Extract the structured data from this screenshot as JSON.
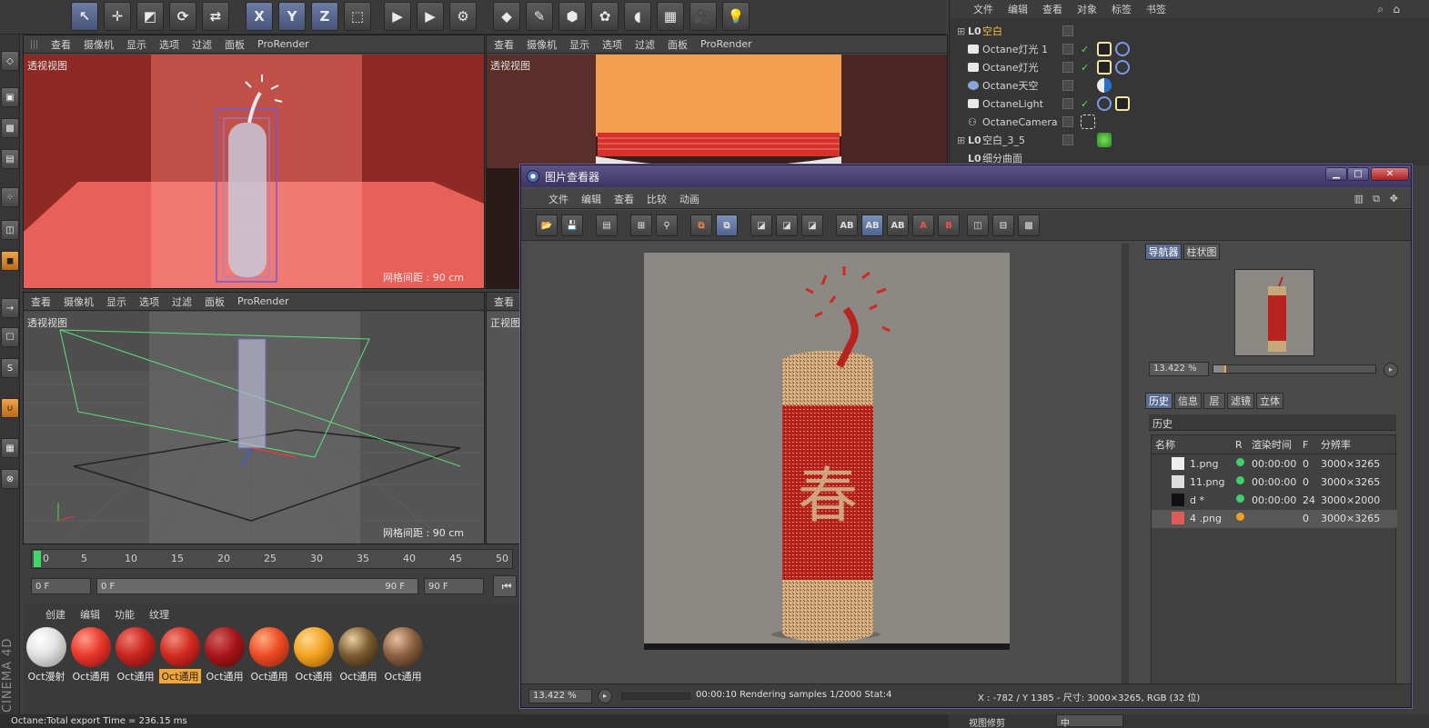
{
  "top_toolbar": {
    "axis_x": "X",
    "axis_y": "Y",
    "axis_z": "Z"
  },
  "viewports": [
    {
      "menu": [
        "查看",
        "摄像机",
        "显示",
        "选项",
        "过滤",
        "面板",
        "ProRender"
      ],
      "label": "透视视图",
      "grid": "网格间距 : 90 cm"
    },
    {
      "menu": [
        "查看",
        "摄像机",
        "显示",
        "选项",
        "过滤",
        "面板",
        "ProRender"
      ],
      "label": "透视视图"
    },
    {
      "menu": [
        "查看",
        "摄像机",
        "显示",
        "选项",
        "过滤",
        "面板",
        "ProRender"
      ],
      "label": "透视视图",
      "grid": "网格间距 : 90 cm"
    },
    {
      "menu": [
        "查看"
      ],
      "label": "正视图"
    }
  ],
  "object_manager": {
    "menu": [
      "文件",
      "编辑",
      "查看",
      "对象",
      "标签",
      "书签"
    ],
    "objects": [
      {
        "name": "空白",
        "highlight": true
      },
      {
        "name": "Octane灯光 1"
      },
      {
        "name": "Octane灯光"
      },
      {
        "name": "Octane天空"
      },
      {
        "name": "OctaneLight"
      },
      {
        "name": "OctaneCamera"
      },
      {
        "name": "空白_3_5"
      },
      {
        "name": "细分曲面"
      }
    ]
  },
  "timeline": {
    "ticks": [
      "0",
      "5",
      "10",
      "15",
      "20",
      "25",
      "30",
      "35",
      "40",
      "45",
      "50"
    ],
    "current_field": "0 F",
    "slider_start": "0 F",
    "slider_end": "90 F",
    "end_field": "90 F"
  },
  "material_manager": {
    "menu": [
      "创建",
      "编辑",
      "功能",
      "纹理"
    ],
    "materials": [
      {
        "label": "Oct漫射",
        "color": "#e4e4e4"
      },
      {
        "label": "Oct通用",
        "color": "#e8372a"
      },
      {
        "label": "Oct通用",
        "color": "#c8241f"
      },
      {
        "label": "Oct通用",
        "color": "#d02a20",
        "selected": true
      },
      {
        "label": "Oct通用",
        "color": "#a8151a"
      },
      {
        "label": "Oct通用",
        "color": "#ee4a22"
      },
      {
        "label": "Oct通用",
        "color": "#f3a21e"
      },
      {
        "label": "Oct通用",
        "color": "#7a5a30"
      },
      {
        "label": "Oct通用",
        "color": "#8a6040"
      }
    ]
  },
  "status_bar": {
    "text": "Octane:Total export Time = 236.15 ms",
    "c4d_logo": "CINEMA 4D",
    "right_label": "视图修剪",
    "right_value": "中"
  },
  "picture_viewer": {
    "title": "图片查看器",
    "menu": [
      "文件",
      "编辑",
      "查看",
      "比较",
      "动画"
    ],
    "side_tabs": [
      "导航器",
      "柱状图"
    ],
    "zoom": "13.422 %",
    "info_tabs": [
      "历史",
      "信息",
      "层",
      "滤镜",
      "立体"
    ],
    "history_title": "历史",
    "history_headers": [
      "名称",
      "R",
      "渲染时间",
      "F",
      "分辨率"
    ],
    "history_rows": [
      {
        "name": "1.png",
        "status_color": "#3fce6a",
        "time": "00:00:00",
        "frame": "0",
        "res": "3000×3265"
      },
      {
        "name": "11.png",
        "status_color": "#3fce6a",
        "time": "00:00:00",
        "frame": "0",
        "res": "3000×3265"
      },
      {
        "name": "d *",
        "status_color": "#3fce6a",
        "time": "00:00:00",
        "frame": "24",
        "res": "3000×2000"
      },
      {
        "name": "4 .png",
        "status_color": "#f0a020",
        "time": "",
        "frame": "0",
        "res": "3000×3265"
      }
    ],
    "status_zoom": "13.422 %",
    "status_render": "00:00:10 Rendering samples 1/2000 Stat:4",
    "status_coords": "X : -782 / Y 1385 - 尺寸: 3000×3265, RGB (32 位)",
    "render_char": "春"
  }
}
